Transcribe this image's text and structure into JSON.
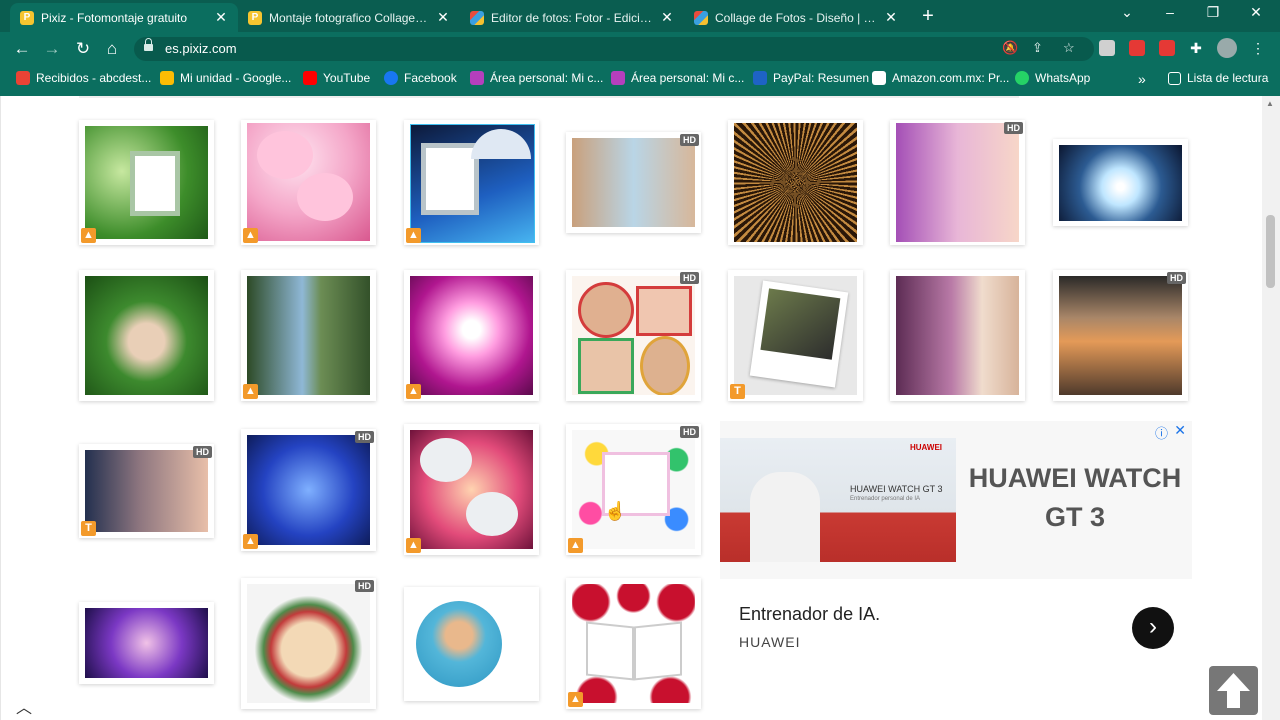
{
  "browser": {
    "tabs": [
      {
        "title": "Pixiz - Fotomontaje gratuito",
        "favicon": "pixiz-icon",
        "active": true
      },
      {
        "title": "Montaje fotografico Collage en fo",
        "favicon": "pixiz-icon",
        "active": false
      },
      {
        "title": "Editor de fotos: Fotor - Edición d",
        "favicon": "fotor-icon",
        "active": false
      },
      {
        "title": "Collage de Fotos - Diseño | Fotor",
        "favicon": "fotor-icon",
        "active": false
      }
    ],
    "new_tab": "+",
    "window_controls": {
      "dropdown": "⌄",
      "minimize": "–",
      "restore": "❐",
      "close": "✕"
    },
    "address": "es.pixiz.com",
    "bookmarks": [
      {
        "label": "Recibidos - abcdest...",
        "icon": "gmail-icon",
        "color": "#ea4335"
      },
      {
        "label": "Mi unidad - Google...",
        "icon": "drive-icon",
        "color": "#fbbc04"
      },
      {
        "label": "YouTube",
        "icon": "youtube-icon",
        "color": "#ff0000"
      },
      {
        "label": "Facebook",
        "icon": "facebook-icon",
        "color": "#1877f2"
      },
      {
        "label": "Área personal: Mi c...",
        "icon": "personal-area-icon",
        "color": "#b53fbd"
      },
      {
        "label": "Área personal: Mi c...",
        "icon": "personal-area-icon",
        "color": "#b53fbd"
      },
      {
        "label": "PayPal: Resumen",
        "icon": "paypal-icon",
        "color": "#1e63c6"
      },
      {
        "label": "Amazon.com.mx: Pr...",
        "icon": "amazon-icon",
        "color": "#ffffff"
      },
      {
        "label": "WhatsApp",
        "icon": "whatsapp-icon",
        "color": "#25d366"
      }
    ],
    "more_bookmarks": "»",
    "reading_list": "Lista de lectura"
  },
  "gallery": [
    {
      "name": "garden-frame",
      "hd": false,
      "badge": "user"
    },
    {
      "name": "pink-hearts-love",
      "hd": false,
      "badge": "user"
    },
    {
      "name": "hello-umbrella-frame",
      "hd": false,
      "badge": "user"
    },
    {
      "name": "couple-blend",
      "hd": true,
      "badge": ""
    },
    {
      "name": "fireworks",
      "hd": false,
      "badge": ""
    },
    {
      "name": "woman-pink-hair",
      "hd": true,
      "badge": ""
    },
    {
      "name": "light-glow",
      "hd": false,
      "badge": ""
    },
    {
      "name": "woman-green-nature",
      "hd": false,
      "badge": ""
    },
    {
      "name": "waterfall-forest",
      "hd": false,
      "badge": "user"
    },
    {
      "name": "heart-just-for-you",
      "hd": false,
      "badge": "user"
    },
    {
      "name": "baby-collage",
      "hd": true,
      "badge": ""
    },
    {
      "name": "polaroid-always-in-my-heart",
      "hd": false,
      "badge": "text"
    },
    {
      "name": "woman-purple-flowers",
      "hd": false,
      "badge": ""
    },
    {
      "name": "beach-couple-photos",
      "hd": true,
      "badge": ""
    },
    {
      "name": "poem-woman",
      "hd": true,
      "badge": "text"
    },
    {
      "name": "blue-butterfly-phone",
      "hd": true,
      "badge": "user"
    },
    {
      "name": "hearts-roses",
      "hd": false,
      "badge": "user"
    },
    {
      "name": "birthday-balloons",
      "hd": true,
      "badge": "user"
    },
    {
      "name": "woman-purple-lights",
      "hd": false,
      "badge": ""
    },
    {
      "name": "rose-wreath-blonde",
      "hd": true,
      "badge": ""
    },
    {
      "name": "man-circle",
      "hd": false,
      "badge": ""
    },
    {
      "name": "roses-open-book",
      "hd": false,
      "badge": "user"
    }
  ],
  "badges": {
    "hd": "HD",
    "text": "T",
    "user": "▲"
  },
  "ad": {
    "info": "ⓘ",
    "close": "✕",
    "brand_logo": "HUAWEI",
    "banner_product": "HUAWEI WATCH GT 3",
    "banner_sub": "Entrenador personal de IA",
    "title": "HUAWEI WATCH GT 3",
    "headline": "Entrenador de IA.",
    "advertiser": "HUAWEI",
    "cta": "›"
  },
  "scroll_top": "scroll-to-top-icon",
  "colors": {
    "chrome": "#0b6e5f",
    "tabstrip": "#0a5d50",
    "omnibox": "#085a4d",
    "badge": "#f39a2b"
  }
}
